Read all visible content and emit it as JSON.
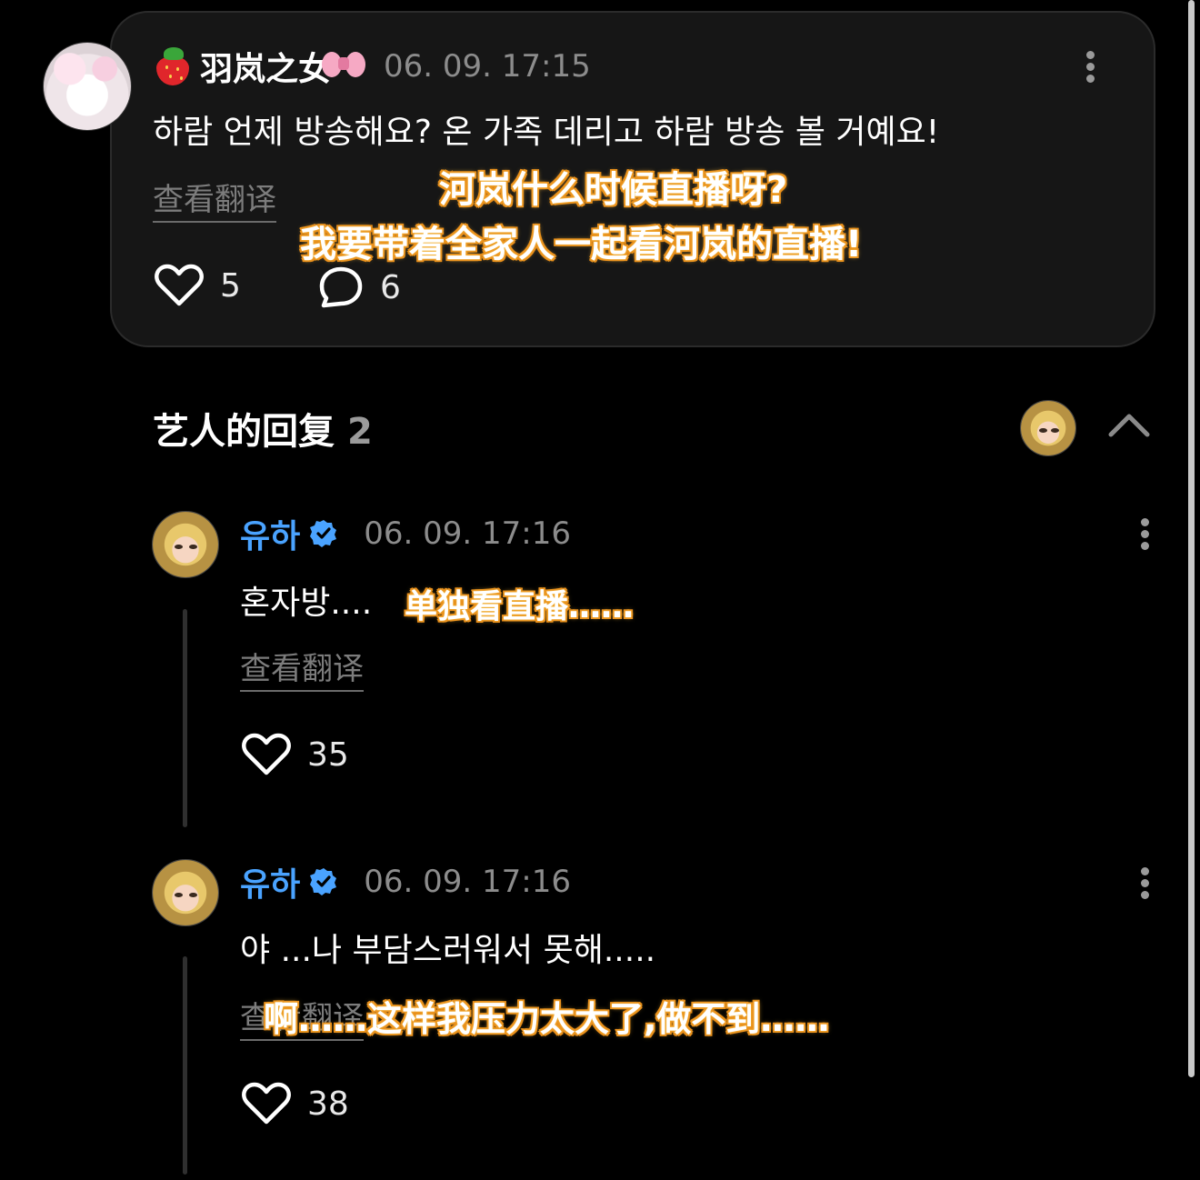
{
  "post": {
    "username": "羽岚之女",
    "timestamp": "06. 09. 17:15",
    "text": "하람 언제 방송해요? 온 가족 데리고 하람 방송 볼 거예요!",
    "translate_label": "查看翻译",
    "likes": "5",
    "comments": "6",
    "subtitle_line1": "河岚什么时候直播呀?",
    "subtitle_line2": "我要带着全家人一起看河岚的直播!"
  },
  "artist_replies": {
    "title": "艺人的回复",
    "count": "2"
  },
  "replies": [
    {
      "username": "유하",
      "timestamp": "06. 09. 17:16",
      "text": "혼자방....",
      "subtitle": "单独看直播……",
      "translate_label": "查看翻译",
      "likes": "35"
    },
    {
      "username": "유하",
      "timestamp": "06. 09. 17:16",
      "text": "야 ...나 부담스러워서 못해.....",
      "subtitle": "啊……这样我压力太大了,做不到……",
      "translate_label": "查看翻译",
      "likes": "38"
    }
  ],
  "icons": {
    "like": "heart-icon",
    "comment": "speech-bubble-icon",
    "more": "kebab-menu-icon",
    "verified": "verified-badge-icon",
    "collapse": "chevron-up-icon"
  },
  "colors": {
    "background": "#000000",
    "card": "#161616",
    "artist_name": "#4aa3ff",
    "timestamp": "#8c8c8c",
    "subtitle_stroke": "#e88d1a"
  }
}
